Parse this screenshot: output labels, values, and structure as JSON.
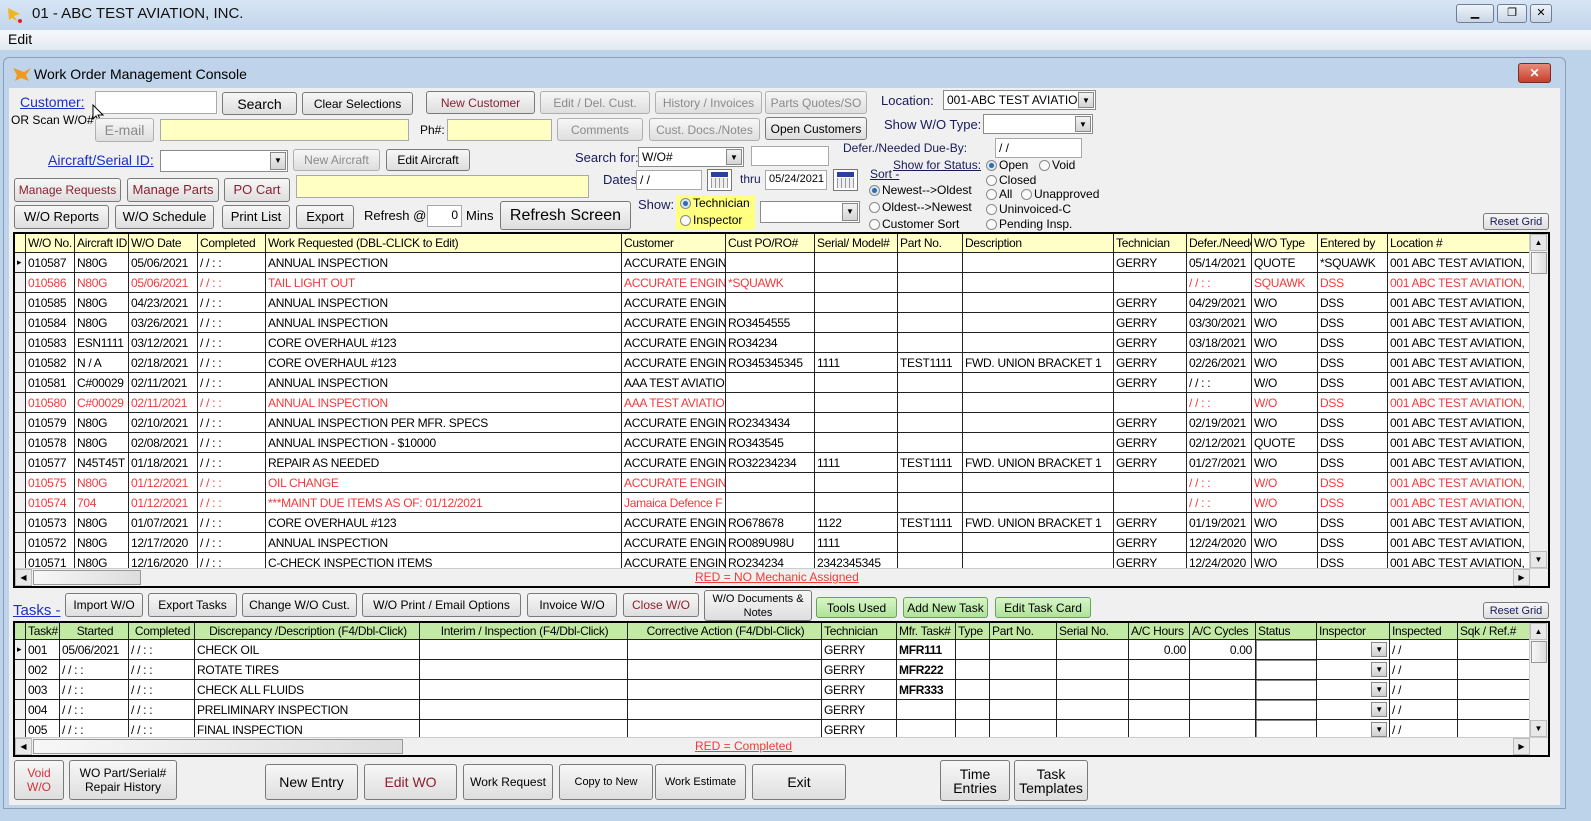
{
  "app": {
    "title": "01 - ABC TEST AVIATION, INC.",
    "menu": [
      "Edit"
    ],
    "window_title": "Work Order Management Console",
    "close": "✕"
  },
  "header": {
    "customer_label": "Customer:",
    "customer_value": "",
    "search": "Search",
    "clear": "Clear Selections",
    "new_customer": "New Customer",
    "edit_del_cust": "Edit / Del. Cust.",
    "history": "History / Invoices",
    "parts_quotes": "Parts Quotes/SO",
    "location_label": "Location:",
    "location_value": "001-ABC TEST AVIATIO",
    "scan_label": "OR Scan W/O#",
    "email": "E-mail",
    "email_value": "",
    "ph_label": "Ph#:",
    "ph_value": "",
    "comments": "Comments",
    "cust_docs": "Cust. Docs./Notes",
    "open_customers": "Open Customers",
    "wo_type_label": "Show W/O Type:",
    "wo_type_value": "",
    "defer_label": "Defer./Needed Due-By:",
    "defer_value": " /  /",
    "aircraft_label": "Aircraft/Serial ID:",
    "aircraft_value": "",
    "new_aircraft": "New Aircraft",
    "edit_aircraft": "Edit Aircraft",
    "search_for_label": "Search for:",
    "search_for_value": "W/O#",
    "search_for_text": "",
    "manage_requests": "Manage Requests",
    "manage_parts": "Manage Parts",
    "po_cart": "PO Cart",
    "info_value": "",
    "dates_label": "Dates",
    "date_from": " /  /",
    "thru_label": "thru",
    "date_to": "05/24/2021",
    "status_label": "Show for Status:",
    "status_options": [
      "Open",
      "Void",
      "Closed",
      "All",
      "Unapproved",
      "Uninvoiced-C",
      "Pending Insp."
    ],
    "status_selected": "Open",
    "sort_label": "Sort -",
    "sort_options": [
      "Newest-->Oldest",
      "Oldest-->Newest",
      "Customer Sort"
    ],
    "wo_reports": "W/O Reports",
    "wo_schedule": "W/O Schedule",
    "print_list": "Print List",
    "export": "Export",
    "refresh_label": "Refresh @",
    "refresh_value": "0",
    "mins": "Mins",
    "refresh_screen": "Refresh Screen",
    "show_label": "Show:",
    "show_options": [
      "Technician",
      "Inspector"
    ],
    "show_value": "",
    "reset_grid": "Reset Grid"
  },
  "work_orders": {
    "columns": [
      "W/O No.",
      "Aircraft ID",
      "W/O Date",
      "Completed",
      "Work Requested    (DBL-CLICK to Edit)",
      "Customer",
      "Cust PO/RO#",
      "Serial/ Model#",
      "Part No.",
      "Description",
      "Technician",
      "Defer./Needed",
      "W/O Type",
      "Entered by",
      "Location #"
    ],
    "rows": [
      {
        "red": false,
        "cells": [
          "010587",
          "N80G",
          "05/06/2021",
          "/ /      : :",
          "ANNUAL INSPECTION",
          "ACCURATE ENGIN",
          "",
          "",
          "",
          "",
          "GERRY",
          "05/14/2021",
          "QUOTE",
          "*SQUAWK",
          "001 ABC TEST AVIATION,"
        ]
      },
      {
        "red": true,
        "cells": [
          "010586",
          "N80G",
          "05/06/2021",
          "/ /      : :",
          "TAIL LIGHT OUT",
          "ACCURATE ENGIN",
          "*SQUAWK",
          "",
          "",
          "",
          "",
          "/ /      : :",
          "SQUAWK",
          "DSS",
          "001 ABC TEST AVIATION,"
        ]
      },
      {
        "red": false,
        "cells": [
          "010585",
          "N80G",
          "04/23/2021",
          "/ /      : :",
          "ANNUAL INSPECTION",
          "ACCURATE ENGIN",
          "",
          "",
          "",
          "",
          "GERRY",
          "04/29/2021",
          "W/O",
          "DSS",
          "001 ABC TEST AVIATION,"
        ]
      },
      {
        "red": false,
        "cells": [
          "010584",
          "N80G",
          "03/26/2021",
          "/ /      : :",
          "ANNUAL INSPECTION",
          "ACCURATE ENGIN",
          "RO3454555",
          "",
          "",
          "",
          "GERRY",
          "03/30/2021",
          "W/O",
          "DSS",
          "001 ABC TEST AVIATION,"
        ]
      },
      {
        "red": false,
        "cells": [
          "010583",
          "ESN1111",
          "03/12/2021",
          "/ /      : :",
          "CORE OVERHAUL #123",
          "ACCURATE ENGIN",
          "RO34234",
          "",
          "",
          "",
          "GERRY",
          "03/18/2021",
          "W/O",
          "DSS",
          "001 ABC TEST AVIATION,"
        ]
      },
      {
        "red": false,
        "cells": [
          "010582",
          "N / A",
          "02/18/2021",
          "/ /      : :",
          "CORE OVERHAUL #123",
          "ACCURATE ENGIN",
          "RO345345345",
          "1111",
          "TEST1111",
          "FWD.  UNION BRACKET 1",
          "GERRY",
          "02/26/2021",
          "W/O",
          "DSS",
          "001 ABC TEST AVIATION,"
        ]
      },
      {
        "red": false,
        "cells": [
          "010581",
          "C#00029",
          "02/11/2021",
          "/ /      : :",
          "ANNUAL INSPECTION",
          "AAA TEST AVIATIOI",
          "",
          "",
          "",
          "",
          "GERRY",
          "/ /      : :",
          "W/O",
          "DSS",
          "001 ABC TEST AVIATION,"
        ]
      },
      {
        "red": true,
        "cells": [
          "010580",
          "C#00029",
          "02/11/2021",
          "/ /      : :",
          "ANNUAL INSPECTION",
          "AAA TEST AVIATIOI",
          "",
          "",
          "",
          "",
          "",
          "/ /      : :",
          "W/O",
          "DSS",
          "001 ABC TEST AVIATION,"
        ]
      },
      {
        "red": false,
        "cells": [
          "010579",
          "N80G",
          "02/10/2021",
          "/ /      : :",
          "ANNUAL INSPECTION PER MFR. SPECS",
          "ACCURATE ENGIN",
          "RO2343434",
          "",
          "",
          "",
          "GERRY",
          "02/19/2021",
          "W/O",
          "DSS",
          "001 ABC TEST AVIATION,"
        ]
      },
      {
        "red": false,
        "cells": [
          "010578",
          "N80G",
          "02/08/2021",
          "/ /      : :",
          "ANNUAL INSPECTION - $10000",
          "ACCURATE ENGIN",
          "RO343545",
          "",
          "",
          "",
          "GERRY",
          "02/12/2021",
          "QUOTE",
          "DSS",
          "001 ABC TEST AVIATION,"
        ]
      },
      {
        "red": false,
        "cells": [
          "010577",
          "N45T45T",
          "01/18/2021",
          "/ /      : :",
          "REPAIR AS NEEDED",
          "ACCURATE ENGIN",
          "RO32234234",
          "1111",
          "TEST1111",
          "FWD.  UNION BRACKET 1",
          "GERRY",
          "01/27/2021",
          "W/O",
          "DSS",
          "001 ABC TEST AVIATION,"
        ]
      },
      {
        "red": true,
        "cells": [
          "010575",
          "N80G",
          "01/12/2021",
          "/ /      : :",
          "OIL CHANGE",
          "ACCURATE ENGIN",
          "",
          "",
          "",
          "",
          "",
          "/ /      : :",
          "W/O",
          "DSS",
          "001 ABC TEST AVIATION,"
        ]
      },
      {
        "red": true,
        "cells": [
          "010574",
          "704",
          "01/12/2021",
          "/ /      : :",
          "***MAINT DUE ITEMS AS OF: 01/12/2021",
          "Jamaica Defence F",
          "",
          "",
          "",
          "",
          "",
          "/ /      : :",
          "W/O",
          "DSS",
          "001 ABC TEST AVIATION,"
        ]
      },
      {
        "red": false,
        "cells": [
          "010573",
          "N80G",
          "01/07/2021",
          "/ /      : :",
          "CORE OVERHAUL #123",
          "ACCURATE ENGIN",
          "RO678678",
          "1122",
          "TEST1111",
          "FWD.  UNION BRACKET 1",
          "GERRY",
          "01/19/2021",
          "W/O",
          "DSS",
          "001 ABC TEST AVIATION,"
        ]
      },
      {
        "red": false,
        "cells": [
          "010572",
          "N80G",
          "12/17/2020",
          "/ /      : :",
          "ANNUAL INSPECTION",
          "ACCURATE ENGIN",
          "RO089U98U",
          "1111",
          "",
          "",
          "GERRY",
          "12/24/2020",
          "W/O",
          "DSS",
          "001 ABC TEST AVIATION,"
        ]
      },
      {
        "red": false,
        "cells": [
          "010571",
          "N80G",
          "12/16/2020",
          "/ /      : :",
          "C-CHECK INSPECTION ITEMS",
          "ACCURATE ENGIN",
          "RO234234",
          "2342345345",
          "",
          "",
          "GERRY",
          "12/24/2020",
          "W/O",
          "DSS",
          "001 ABC TEST AVIATION,"
        ]
      }
    ],
    "legend": "RED = NO Mechanic Assigned",
    "highlight_color": "#f03a3a",
    "header_color": "#ffffc8"
  },
  "tasks_toolbar": {
    "label": "Tasks -",
    "import": "Import W/O",
    "export": "Export Tasks",
    "change_cust": "Change W/O Cust.",
    "print_email": "W/O Print / Email Options",
    "invoice": "Invoice W/O",
    "close": "Close W/O",
    "documents": "W/O Documents & Notes",
    "tools_used": "Tools Used",
    "add_task": "Add New Task",
    "edit_task_card": "Edit Task Card",
    "reset_grid": "Reset Grid"
  },
  "tasks": {
    "columns": [
      "Task#",
      "Started",
      "Completed",
      "Discrepancy /Description  (F4/Dbl-Click)",
      "Interim / Inspection (F4/Dbl-Click)",
      "Corrective Action (F4/Dbl-Click)",
      "Technician",
      "Mfr. Task#",
      "Type",
      "Part No.",
      "Serial No.",
      "A/C Hours",
      "A/C Cycles",
      "Status",
      "Inspector",
      "Inspected",
      "Sqk / Ref.#"
    ],
    "rows": [
      {
        "cells": [
          "001",
          "05/06/2021",
          "/ /      : :",
          "CHECK OIL",
          "",
          "",
          "GERRY",
          "MFR111",
          "",
          "",
          "",
          "0.00",
          "0.00",
          "",
          "",
          "/ /",
          ""
        ]
      },
      {
        "cells": [
          "002",
          "/ /      : :",
          "/ /      : :",
          "ROTATE TIRES",
          "",
          "",
          "GERRY",
          "MFR222",
          "",
          "",
          "",
          "",
          "",
          "",
          "",
          "/ /",
          ""
        ]
      },
      {
        "cells": [
          "003",
          "/ /      : :",
          "/ /      : :",
          "CHECK ALL FLUIDS",
          "",
          "",
          "GERRY",
          "MFR333",
          "",
          "",
          "",
          "",
          "",
          "",
          "",
          "/ /",
          ""
        ]
      },
      {
        "cells": [
          "004",
          "/ /      : :",
          "/ /      : :",
          "PRELIMINARY INSPECTION",
          "",
          "",
          "GERRY",
          "",
          "",
          "",
          "",
          "",
          "",
          "",
          "",
          "/ /",
          ""
        ]
      },
      {
        "cells": [
          "005",
          "/ /      : :",
          "/ /      : :",
          "FINAL INSPECTION",
          "",
          "",
          "GERRY",
          "",
          "",
          "",
          "",
          "",
          "",
          "",
          "",
          "/ /",
          ""
        ]
      }
    ],
    "legend": "RED = Completed",
    "header_color": "#c3eaa4"
  },
  "footer": {
    "void": "Void W/O",
    "repair_history": "WO Part/Serial# Repair History",
    "new_entry": "New Entry",
    "edit_wo": "Edit WO",
    "work_request": "Work Request",
    "copy_to_new": "Copy to New",
    "work_estimate": "Work Estimate",
    "exit": "Exit",
    "time_entries": "Time Entries",
    "task_templates": "Task Templates"
  }
}
